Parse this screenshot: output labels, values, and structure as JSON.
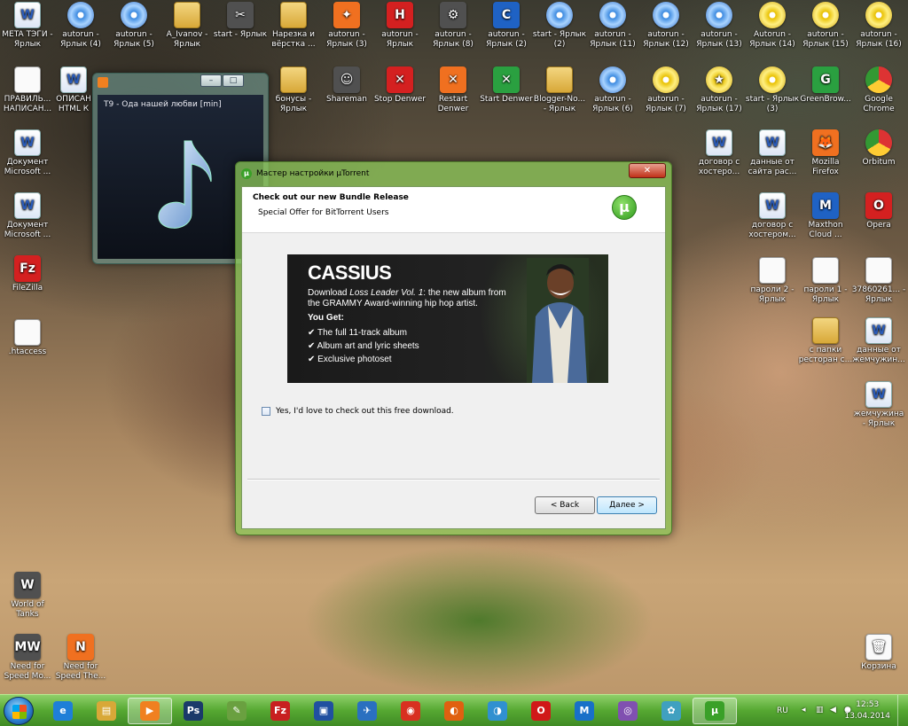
{
  "desktop_icons": [
    {
      "label": "META ТЭГИ - Ярлык",
      "kind": "doc",
      "glyph": "W"
    },
    {
      "label": "autorun - Ярлык (4)",
      "kind": "cd",
      "glyph": ""
    },
    {
      "label": "autorun - Ярлык (5)",
      "kind": "cd",
      "glyph": ""
    },
    {
      "label": "A_Ivanov - Ярлык",
      "kind": "folder",
      "glyph": ""
    },
    {
      "label": "start - Ярлык",
      "kind": "gray",
      "glyph": "✂"
    },
    {
      "label": "Нарезка и вёрстка ...",
      "kind": "folder",
      "glyph": ""
    },
    {
      "label": "autorun - Ярлык (3)",
      "kind": "orange",
      "glyph": "✦"
    },
    {
      "label": "autorun - Ярлык",
      "kind": "red",
      "glyph": "H"
    },
    {
      "label": "autorun - Ярлык (8)",
      "kind": "gray",
      "glyph": "⚙"
    },
    {
      "label": "autorun - Ярлык (2)",
      "kind": "blue",
      "glyph": "C"
    },
    {
      "label": "start - Ярлык (2)",
      "kind": "cd",
      "glyph": ""
    },
    {
      "label": "autorun - Ярлык (11)",
      "kind": "cd",
      "glyph": ""
    },
    {
      "label": "autorun - Ярлык (12)",
      "kind": "cd",
      "glyph": ""
    },
    {
      "label": "autorun - Ярлык (13)",
      "kind": "cd",
      "glyph": ""
    },
    {
      "label": "Autorun - Ярлык (14)",
      "kind": "cdy",
      "glyph": ""
    },
    {
      "label": "autorun - Ярлык (15)",
      "kind": "cdy",
      "glyph": ""
    },
    {
      "label": "autorun - Ярлык (16)",
      "kind": "cdy",
      "glyph": ""
    },
    {
      "label": "ПРАВИЛЬ... НАПИСАН...",
      "kind": "white",
      "glyph": ""
    },
    {
      "label": "ОПИСАН HTML К",
      "kind": "doc",
      "glyph": "W"
    },
    {
      "label": "бонусы - Ярлык",
      "kind": "folder",
      "glyph": ""
    },
    {
      "label": "Shareman",
      "kind": "gray",
      "glyph": "☺"
    },
    {
      "label": "Stop Denwer",
      "kind": "red",
      "glyph": "✕"
    },
    {
      "label": "Restart Denwer",
      "kind": "orange",
      "glyph": "✕"
    },
    {
      "label": "Start Denwer",
      "kind": "green",
      "glyph": "✕"
    },
    {
      "label": "Blogger-No... - Ярлык",
      "kind": "folder",
      "glyph": ""
    },
    {
      "label": "autorun - Ярлык (6)",
      "kind": "cd",
      "glyph": ""
    },
    {
      "label": "autorun - Ярлык (7)",
      "kind": "cdy",
      "glyph": ""
    },
    {
      "label": "autorun - Ярлык (17)",
      "kind": "cdy",
      "glyph": "★"
    },
    {
      "label": "start - Ярлык (3)",
      "kind": "cdy",
      "glyph": ""
    },
    {
      "label": "GreenBrow...",
      "kind": "green",
      "glyph": "G"
    },
    {
      "label": "Google Chrome",
      "kind": "chrome",
      "glyph": ""
    },
    {
      "label": "Документ Microsoft ...",
      "kind": "doc",
      "glyph": "W"
    },
    {
      "label": "Документ Microsoft ...",
      "kind": "doc",
      "glyph": "W"
    },
    {
      "label": "FileZilla",
      "kind": "red",
      "glyph": "Fz"
    },
    {
      "label": ".htaccess",
      "kind": "white",
      "glyph": ""
    },
    {
      "label": "договор с хостеро...",
      "kind": "doc",
      "glyph": "W"
    },
    {
      "label": "данные от сайта рас...",
      "kind": "doc",
      "glyph": "W"
    },
    {
      "label": "Mozilla Firefox",
      "kind": "orange",
      "glyph": "🦊"
    },
    {
      "label": "Orbitum",
      "kind": "chrome",
      "glyph": ""
    },
    {
      "label": "договор с хостером...",
      "kind": "doc",
      "glyph": "W"
    },
    {
      "label": "Maxthon Cloud ...",
      "kind": "blue",
      "glyph": "M"
    },
    {
      "label": "Opera",
      "kind": "red",
      "glyph": "O"
    },
    {
      "label": "пароли 2 - Ярлык",
      "kind": "white",
      "glyph": ""
    },
    {
      "label": "пароли 1 - Ярлык",
      "kind": "white",
      "glyph": ""
    },
    {
      "label": "37860261... - Ярлык",
      "kind": "white",
      "glyph": ""
    },
    {
      "label": "с папки ресторан с...",
      "kind": "folder",
      "glyph": ""
    },
    {
      "label": "данные от жемчужин...",
      "kind": "doc",
      "glyph": "W"
    },
    {
      "label": "жемчужина - Ярлык",
      "kind": "doc",
      "glyph": "W"
    },
    {
      "label": "World of Tanks",
      "kind": "gray",
      "glyph": "W"
    },
    {
      "label": "Need for Speed Mo...",
      "kind": "gray",
      "glyph": "MW"
    },
    {
      "label": "Need for Speed The...",
      "kind": "orange",
      "glyph": "N"
    },
    {
      "label": "Корзина",
      "kind": "white",
      "glyph": "🗑"
    }
  ],
  "media_window": {
    "track_title": "T9 - Ода нашей любви [min]",
    "minimize_label": "–",
    "maximize_label": "□"
  },
  "dialog": {
    "title": "Мастер настройки µTorrent",
    "close_label": "✕",
    "header_title": "Check out our new Bundle Release",
    "header_subtitle": "Special Offer for BitTorrent Users",
    "logo_glyph": "µ",
    "banner": {
      "title": "CASSIUS",
      "desc_prefix": "Download ",
      "desc_album": "Loss Leader Vol. 1",
      "desc_suffix": ": the new album from the GRAMMY Award-winning hip hop artist.",
      "you_get": "You Get:",
      "items": [
        "The full 11-track album",
        "Album art and lyric sheets",
        "Exclusive photoset"
      ]
    },
    "checkbox_label": "Yes, I'd love to check out this free download.",
    "checkbox_checked": false,
    "back_label": "< Back",
    "next_label": "Далее >"
  },
  "taskbar": {
    "apps": [
      {
        "name": "ie",
        "glyph": "e",
        "color": "#1e7fd8",
        "active": false
      },
      {
        "name": "explorer",
        "glyph": "▤",
        "color": "#d8a838",
        "active": false
      },
      {
        "name": "media-player",
        "glyph": "▶",
        "color": "#f08020",
        "active": true
      },
      {
        "name": "photoshop",
        "glyph": "Ps",
        "color": "#1a3a6a",
        "active": false
      },
      {
        "name": "notepad",
        "glyph": "✎",
        "color": "#6aa040",
        "active": false
      },
      {
        "name": "filezilla",
        "glyph": "Fz",
        "color": "#c82020",
        "active": false
      },
      {
        "name": "save",
        "glyph": "▣",
        "color": "#2050a0",
        "active": false
      },
      {
        "name": "thunderbird",
        "glyph": "✈",
        "color": "#2a70c0",
        "active": false
      },
      {
        "name": "chrome",
        "glyph": "◉",
        "color": "#d83020",
        "active": false
      },
      {
        "name": "firefox",
        "glyph": "◐",
        "color": "#e06010",
        "active": false
      },
      {
        "name": "orbitum",
        "glyph": "◑",
        "color": "#3090d0",
        "active": false
      },
      {
        "name": "opera",
        "glyph": "O",
        "color": "#d01818",
        "active": false
      },
      {
        "name": "maxthon",
        "glyph": "M",
        "color": "#1870c8",
        "active": false
      },
      {
        "name": "tor",
        "glyph": "◎",
        "color": "#8050b0",
        "active": false
      },
      {
        "name": "paint",
        "glyph": "✿",
        "color": "#40a0c0",
        "active": false
      },
      {
        "name": "utorrent",
        "glyph": "µ",
        "color": "#3aa028",
        "active": true
      }
    ],
    "lang": "RU",
    "time": "12:53",
    "date": "13.04.2014"
  }
}
